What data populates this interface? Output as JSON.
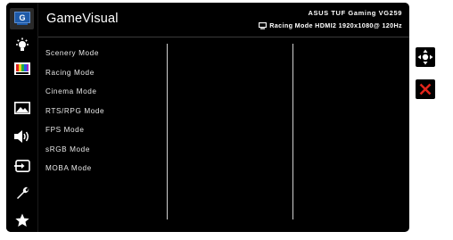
{
  "osd": {
    "title": "GameVisual",
    "model": "ASUS TUF Gaming  VG259",
    "status": "Racing Mode HDMI2 1920x1080@ 120Hz"
  },
  "rail": {
    "active_label": "G",
    "icons": [
      "gamevisual-icon",
      "brightness-icon",
      "color-icon",
      "image-icon",
      "sound-icon",
      "input-select-icon",
      "system-setup-icon",
      "favorite-icon"
    ]
  },
  "menu": {
    "items": [
      "Scenery Mode",
      "Racing Mode",
      "Cinema Mode",
      "RTS/RPG Mode",
      "FPS Mode",
      "sRGB Mode",
      "MOBA Mode"
    ]
  },
  "side_buttons": [
    "navigate-icon",
    "close-icon"
  ],
  "colors": {
    "accent_blue": "#1e5aa8",
    "close_red": "#e0251b",
    "background": "#000000"
  }
}
